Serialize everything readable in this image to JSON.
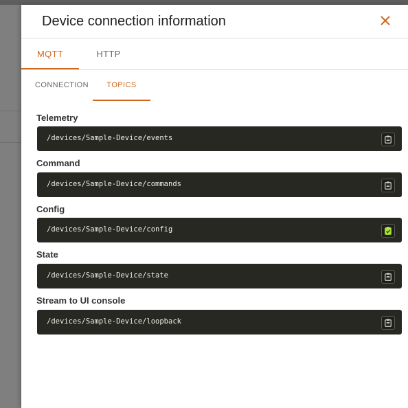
{
  "dialog": {
    "title": "Device connection information"
  },
  "tabs": {
    "mqtt": "MQTT",
    "http": "HTTP"
  },
  "subtabs": {
    "connection": "CONNECTION",
    "topics": "TOPICS"
  },
  "topics": [
    {
      "label": "Telemetry",
      "value": "/devices/Sample-Device/events",
      "copied": false
    },
    {
      "label": "Command",
      "value": "/devices/Sample-Device/commands",
      "copied": false
    },
    {
      "label": "Config",
      "value": "/devices/Sample-Device/config",
      "copied": true
    },
    {
      "label": "State",
      "value": "/devices/Sample-Device/state",
      "copied": false
    },
    {
      "label": "Stream to UI console",
      "value": "/devices/Sample-Device/loopback",
      "copied": false
    }
  ],
  "colors": {
    "accent": "#d2691e",
    "code_bg": "#272822",
    "copied_green": "#a6e22e"
  },
  "icons": {
    "close": "close-icon",
    "copy": "clipboard-icon",
    "copied": "clipboard-check-icon"
  }
}
